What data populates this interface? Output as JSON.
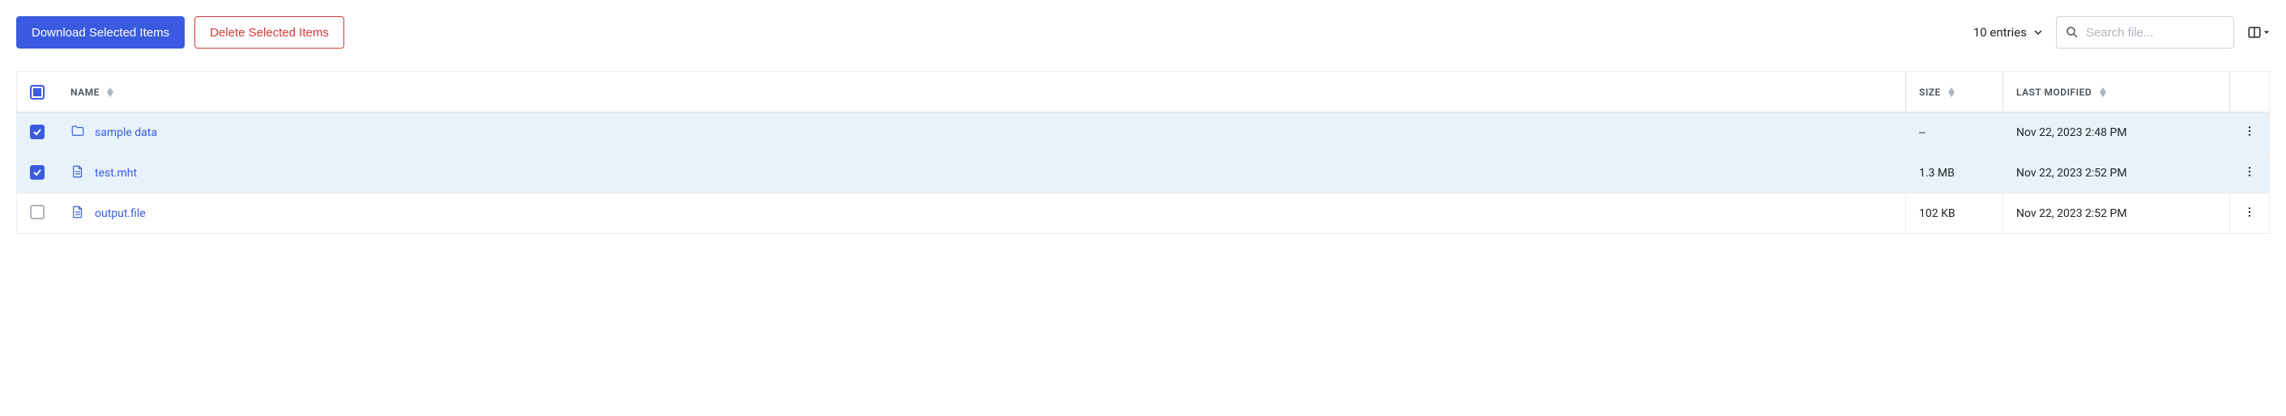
{
  "toolbar": {
    "download_label": "Download Selected Items",
    "delete_label": "Delete Selected Items",
    "entries_label": "10 entries",
    "search_placeholder": "Search file..."
  },
  "columns": {
    "name": "Name",
    "size": "Size",
    "modified": "Last Modified"
  },
  "rows": [
    {
      "selected": true,
      "icon": "folder",
      "name": "sample data",
      "size": "--",
      "modified": "Nov 22, 2023 2:48 PM"
    },
    {
      "selected": true,
      "icon": "file",
      "name": "test.mht",
      "size": "1.3 MB",
      "modified": "Nov 22, 2023 2:52 PM"
    },
    {
      "selected": false,
      "icon": "file",
      "name": "output.file",
      "size": "102 KB",
      "modified": "Nov 22, 2023 2:52 PM"
    }
  ]
}
